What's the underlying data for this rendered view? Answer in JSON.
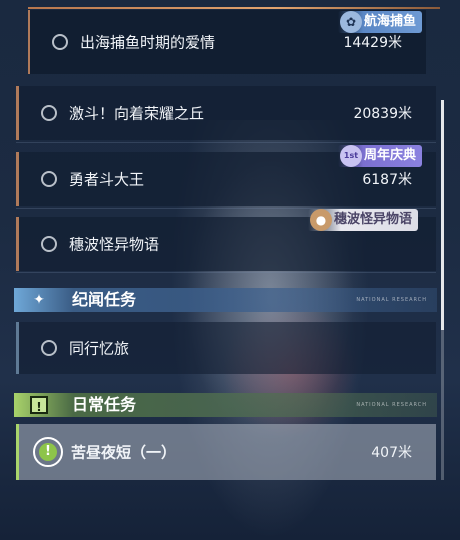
{
  "quests_top": [
    {
      "name": "出海捕鱼时期的爱情",
      "distance": "14429米"
    },
    {
      "name": "激斗！向着荣耀之丘",
      "distance": "20839米"
    },
    {
      "name": "勇者斗大王",
      "distance": "6187米"
    },
    {
      "name": "穗波怪异物语",
      "distance": ""
    }
  ],
  "tags": {
    "fishing": "航海捕鱼",
    "anniversary_num": "1st",
    "anniversary": "周年庆典",
    "wave": "穗波怪异物语"
  },
  "sections": {
    "story": {
      "title": "纪闻任务",
      "deco": "NATIONAL RESEARCH"
    },
    "daily": {
      "title": "日常任务",
      "deco": "NATIONAL RESEARCH"
    }
  },
  "story_quests": [
    {
      "name": "同行忆旅"
    }
  ],
  "daily_quests": [
    {
      "name": "苦昼夜短（一）",
      "distance": "407米"
    }
  ],
  "colors": {
    "accent_daily": "#a9d56c",
    "accent_story": "#6fa8d8",
    "quest_border": "#b07a5a"
  }
}
